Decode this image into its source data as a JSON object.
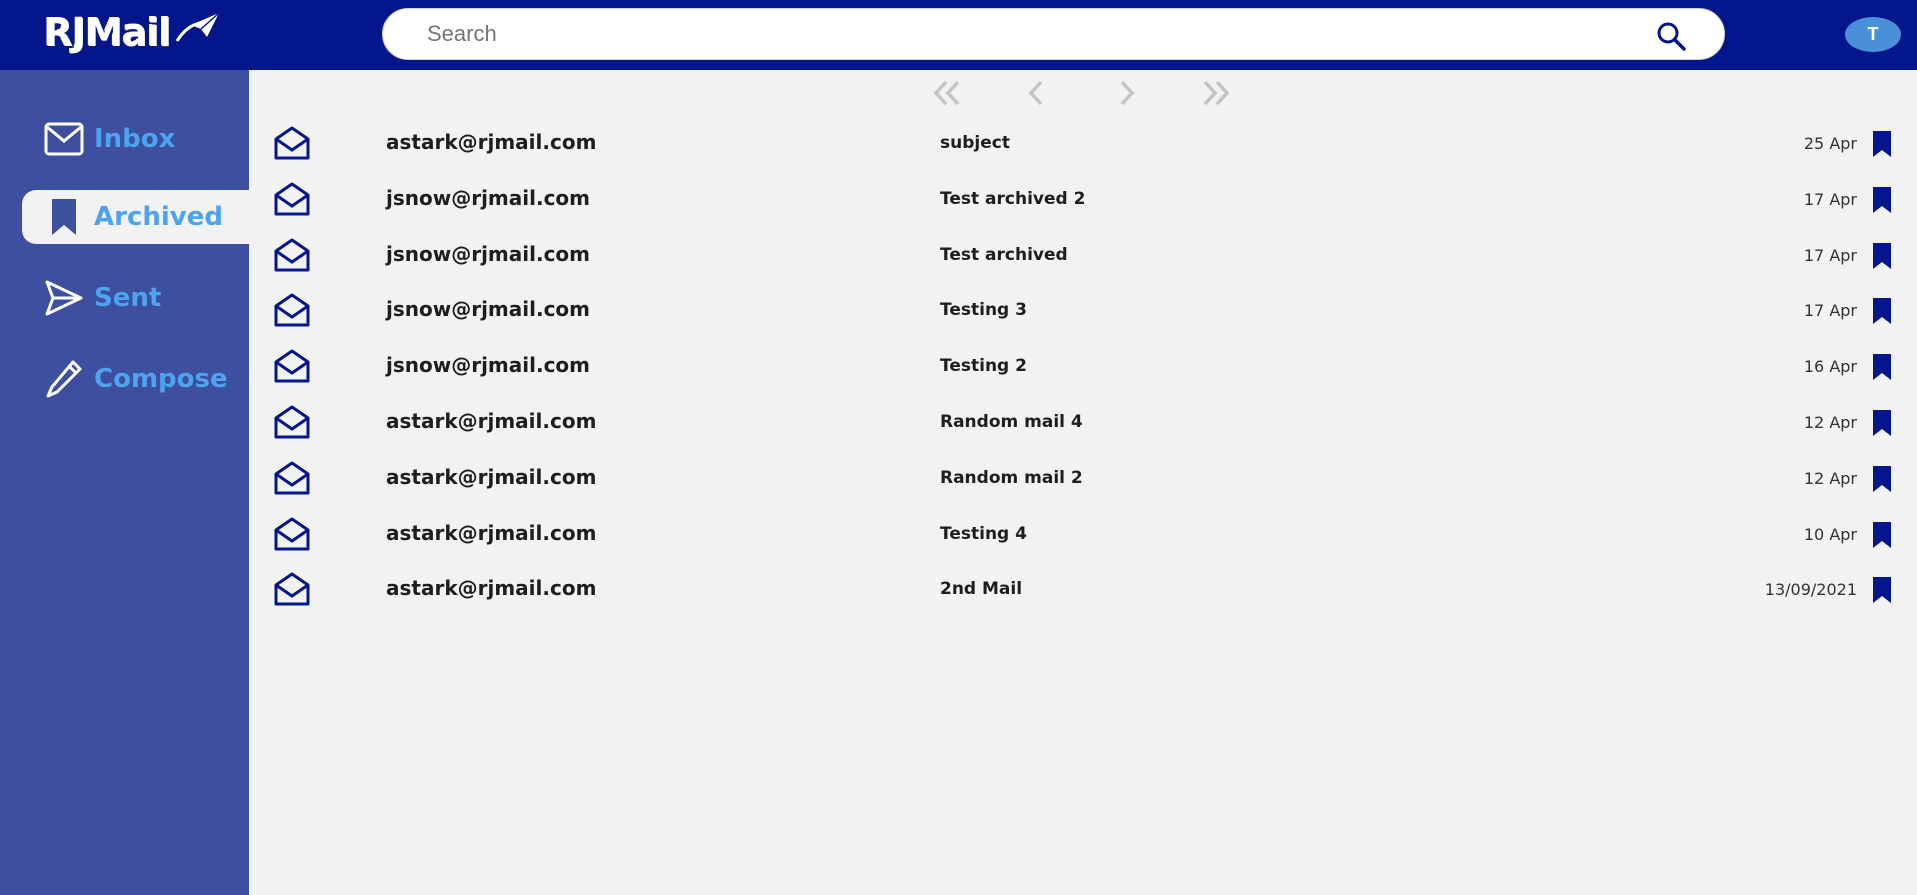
{
  "app": {
    "name": "RJMail"
  },
  "search": {
    "placeholder": "Search"
  },
  "user": {
    "initial": "T"
  },
  "colors": {
    "header": "#03168c",
    "sidebar": "#3d4f9e",
    "accent": "#4ea3f0",
    "icon": "#03168c"
  },
  "sidebar": {
    "items": [
      {
        "label": "Inbox",
        "icon": "envelope-icon",
        "active": false
      },
      {
        "label": "Archived",
        "icon": "bookmark-icon",
        "active": true
      },
      {
        "label": "Sent",
        "icon": "paper-plane-icon",
        "active": false
      },
      {
        "label": "Compose",
        "icon": "pencil-icon",
        "active": false
      }
    ]
  },
  "pagination": {
    "icons": [
      "first-page-icon",
      "prev-page-icon",
      "next-page-icon",
      "last-page-icon"
    ]
  },
  "mails": [
    {
      "from": "astark@rjmail.com",
      "subject": "subject",
      "date": "25 Apr"
    },
    {
      "from": "jsnow@rjmail.com",
      "subject": "Test archived 2",
      "date": "17 Apr"
    },
    {
      "from": "jsnow@rjmail.com",
      "subject": "Test archived",
      "date": "17 Apr"
    },
    {
      "from": "jsnow@rjmail.com",
      "subject": "Testing 3",
      "date": "17 Apr"
    },
    {
      "from": "jsnow@rjmail.com",
      "subject": "Testing 2",
      "date": "16 Apr"
    },
    {
      "from": "astark@rjmail.com",
      "subject": "Random mail 4",
      "date": "12 Apr"
    },
    {
      "from": "astark@rjmail.com",
      "subject": "Random mail 2",
      "date": "12 Apr"
    },
    {
      "from": "astark@rjmail.com",
      "subject": "Testing 4",
      "date": "10 Apr"
    },
    {
      "from": "astark@rjmail.com",
      "subject": "2nd Mail",
      "date": "13/09/2021"
    }
  ]
}
